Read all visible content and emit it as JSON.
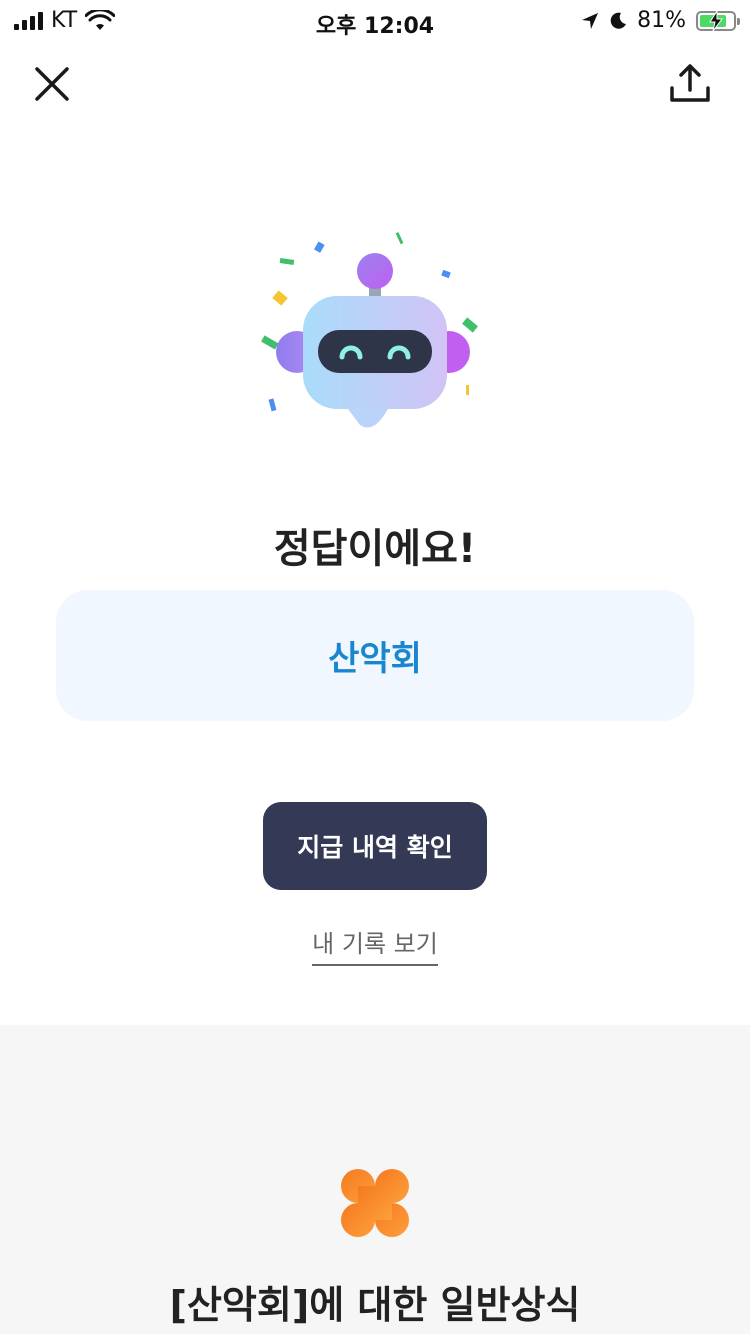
{
  "status_bar": {
    "carrier": "KT",
    "time": "오후 12:04",
    "battery": "81%",
    "battery_level": 0.81
  },
  "nav": {
    "close_icon": "close-icon",
    "share_icon": "share-upload-icon"
  },
  "result": {
    "title": "정답이에요!",
    "answer": "산악회",
    "colors": {
      "answer_text": "#1b86d0",
      "answer_bg": "#f0f7fe",
      "button_bg": "#343a56"
    }
  },
  "actions": {
    "primary_label": "지급 내역 확인",
    "secondary_link": "내 기록 보기"
  },
  "info_section": {
    "icon": "clover-icon",
    "title": "[산악회]에 대한 일반상식"
  }
}
